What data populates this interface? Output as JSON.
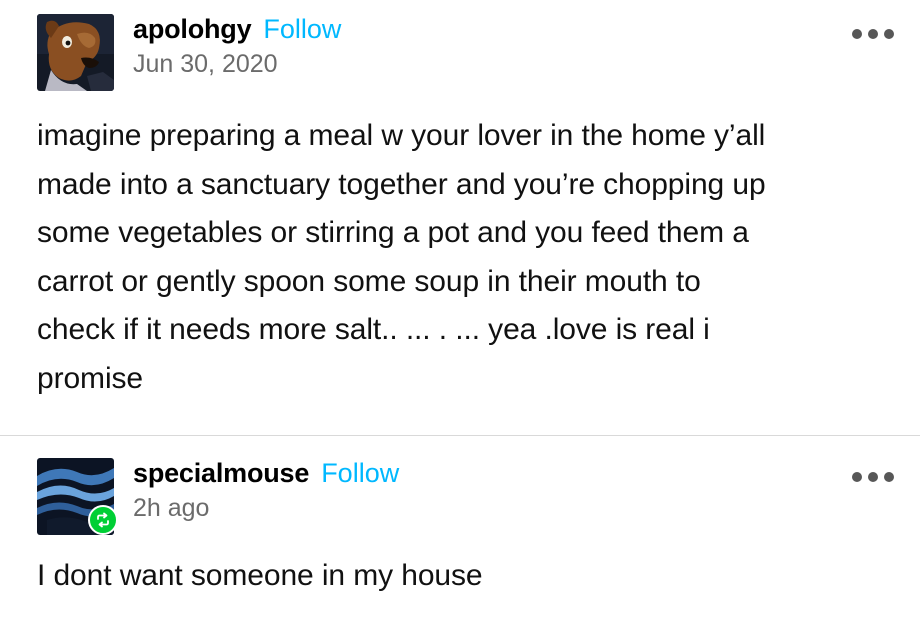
{
  "posts": [
    {
      "username": "apolohgy",
      "follow_label": "Follow",
      "timestamp": "Jun 30, 2020",
      "avatar_icon": "cartoon-dog-avatar",
      "more_icon": "more-options-icon",
      "body": "imagine preparing a meal w your lover in the home y’all\nmade into a sanctuary together and you’re chopping up\nsome vegetables or stirring a pot and you feed them a\ncarrot or gently spoon some soup in their mouth to\ncheck if it needs more salt.. ...  . ... yea .love is real i\npromise"
    },
    {
      "username": "specialmouse",
      "follow_label": "Follow",
      "timestamp": "2h ago",
      "avatar_icon": "blue-waves-avatar",
      "reblog_icon": "reblog-icon",
      "more_icon": "more-options-icon",
      "body": "I dont want someone in my house"
    }
  ],
  "colors": {
    "follow": "#00b8ff",
    "reblog_badge": "#00cf35",
    "timestamp": "#6b6b6b",
    "divider": "#d9d9d9"
  }
}
